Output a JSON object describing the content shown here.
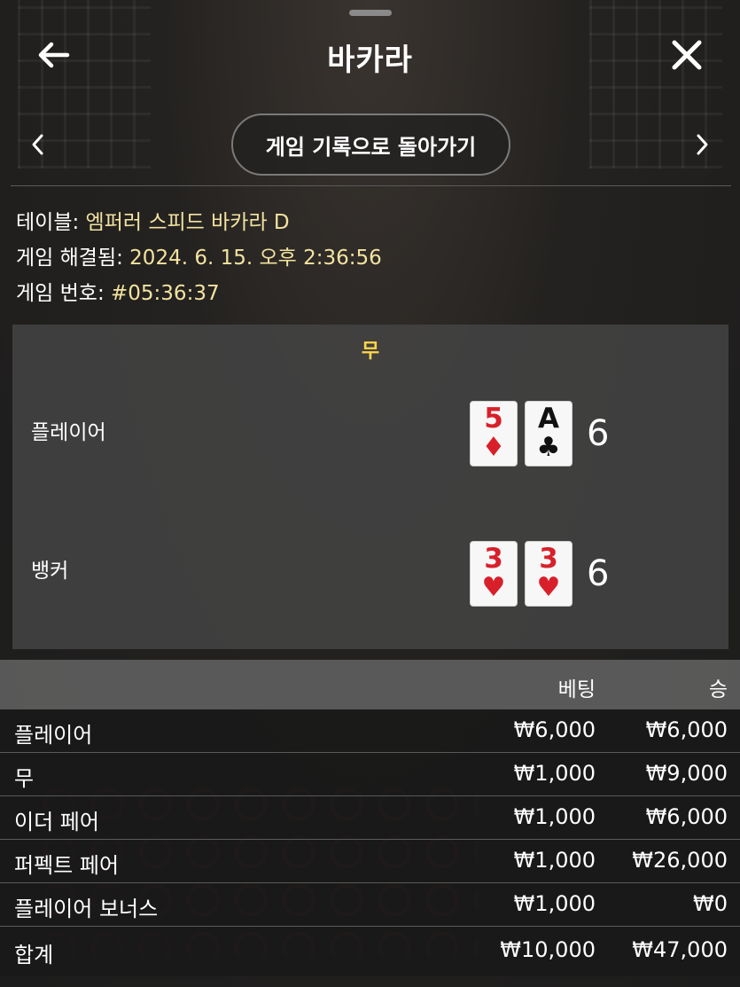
{
  "header": {
    "title": "바카라"
  },
  "nav": {
    "history_button": "게임 기록으로 돌아가기"
  },
  "info": {
    "table_label": "테이블: ",
    "table_value": "엠퍼러 스피드 바카라 D",
    "resolved_label": "게임 해결됨: ",
    "resolved_value": "2024. 6. 15. 오후 2:36:56",
    "number_label": "게임 번호: ",
    "number_value": "#05:36:37"
  },
  "result": {
    "outcome": "무",
    "player": {
      "label": "플레이어",
      "cards": [
        {
          "rank": "5",
          "suit": "♦",
          "color": "red"
        },
        {
          "rank": "A",
          "suit": "♣",
          "color": "black"
        }
      ],
      "score": "6"
    },
    "banker": {
      "label": "뱅커",
      "cards": [
        {
          "rank": "3",
          "suit": "♥",
          "color": "red"
        },
        {
          "rank": "3",
          "suit": "♥",
          "color": "red"
        }
      ],
      "score": "6"
    }
  },
  "bets_table": {
    "header_bet": "베팅",
    "header_win": "승",
    "rows": [
      {
        "label": "플레이어",
        "bet": "₩6,000",
        "win": "₩6,000"
      },
      {
        "label": "무",
        "bet": "₩1,000",
        "win": "₩9,000"
      },
      {
        "label": "이더 페어",
        "bet": "₩1,000",
        "win": "₩6,000"
      },
      {
        "label": "퍼펙트 페어",
        "bet": "₩1,000",
        "win": "₩26,000"
      },
      {
        "label": "플레이어 보너스",
        "bet": "₩1,000",
        "win": "₩0"
      }
    ],
    "total": {
      "label": "합계",
      "bet": "₩10,000",
      "win": "₩47,000"
    }
  },
  "colors": {
    "accent_value": "#f3e3a0",
    "outcome": "#ffd74a",
    "card_red": "#d8202a"
  },
  "icons": {
    "back": "arrow-left-icon",
    "close": "close-icon",
    "prev": "chevron-left-icon",
    "next": "chevron-right-icon"
  }
}
